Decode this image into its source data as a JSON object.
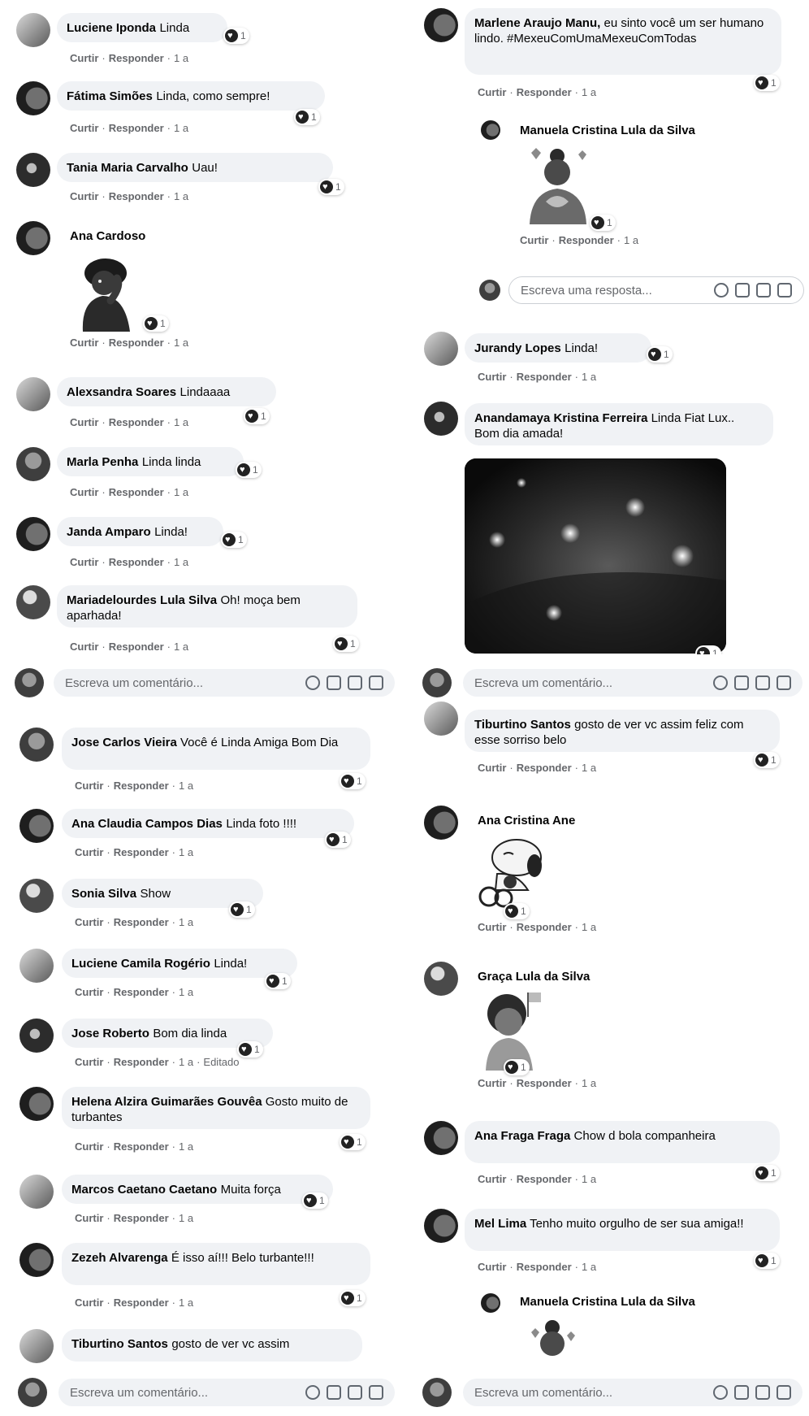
{
  "ui": {
    "like": "Curtir",
    "reply": "Responder",
    "time": "1 a",
    "sep": "·",
    "comment_placeholder": "Escreva um comentário...",
    "reply_placeholder": "Escreva uma resposta...",
    "reaction_count": "1"
  },
  "top_left": {
    "comments": [
      {
        "name": "Luciene Iponda",
        "text": "Linda"
      },
      {
        "name": "Fátima Simões",
        "text": "Linda, como sempre!"
      },
      {
        "name": "Tania Maria Carvalho",
        "text": "Uau!"
      },
      {
        "name": "Ana Cardoso",
        "text": ""
      },
      {
        "name": "Alexsandra Soares",
        "text": "Lindaaaa"
      },
      {
        "name": "Marla Penha",
        "text": "Linda linda"
      },
      {
        "name": "Janda Amparo",
        "text": "Linda!"
      },
      {
        "name": "Mariadelourdes Lula Silva",
        "text": "Oh! moça bem aparhada!"
      }
    ]
  },
  "top_right": {
    "comments": [
      {
        "name": "Marlene Araujo Manu,",
        "text": "eu sinto você um ser humano lindo. #MexeuComUmaMexeuComTodas"
      },
      {
        "name": "Manuela Cristina Lula da Silva",
        "text": ""
      },
      {
        "name": "Jurandy Lopes",
        "text": "Linda!"
      },
      {
        "name": "Anandamaya Kristina Ferreira",
        "text": "Linda Fiat Lux.. Bom dia amada!"
      }
    ]
  },
  "bottom_left": {
    "comments": [
      {
        "name": "Jose Carlos Vieira",
        "text": "Você é Linda Amiga Bom Dia"
      },
      {
        "name": "Ana Claudia Campos Dias",
        "text": "Linda foto !!!!"
      },
      {
        "name": "Sonia Silva",
        "text": "Show"
      },
      {
        "name": "Luciene Camila Rogério",
        "text": "Linda!"
      },
      {
        "name": "Jose Roberto",
        "text": "Bom dia linda"
      },
      {
        "name": "Helena Alzira Guimarães Gouvêa",
        "text": "Gosto muito de turbantes"
      },
      {
        "name": "Marcos Caetano Caetano",
        "text": "Muita força"
      },
      {
        "name": "Zezeh Alvarenga",
        "text": "É isso aí!!! Belo turbante!!!"
      },
      {
        "name": "Tiburtino Santos",
        "text": "gosto de ver vc assim"
      }
    ],
    "edited": "Editado"
  },
  "bottom_right": {
    "comments": [
      {
        "name": "Tiburtino Santos",
        "text": "gosto de ver vc assim feliz com esse sorriso belo"
      },
      {
        "name": "Ana Cristina Ane",
        "text": ""
      },
      {
        "name": "Graça Lula da Silva",
        "text": ""
      },
      {
        "name": "Ana Fraga Fraga",
        "text": "Chow d bola companheira"
      },
      {
        "name": "Mel Lima",
        "text": "Tenho muito orgulho de ser sua amiga!!"
      },
      {
        "name": "Manuela Cristina Lula da Silva",
        "text": ""
      }
    ]
  }
}
